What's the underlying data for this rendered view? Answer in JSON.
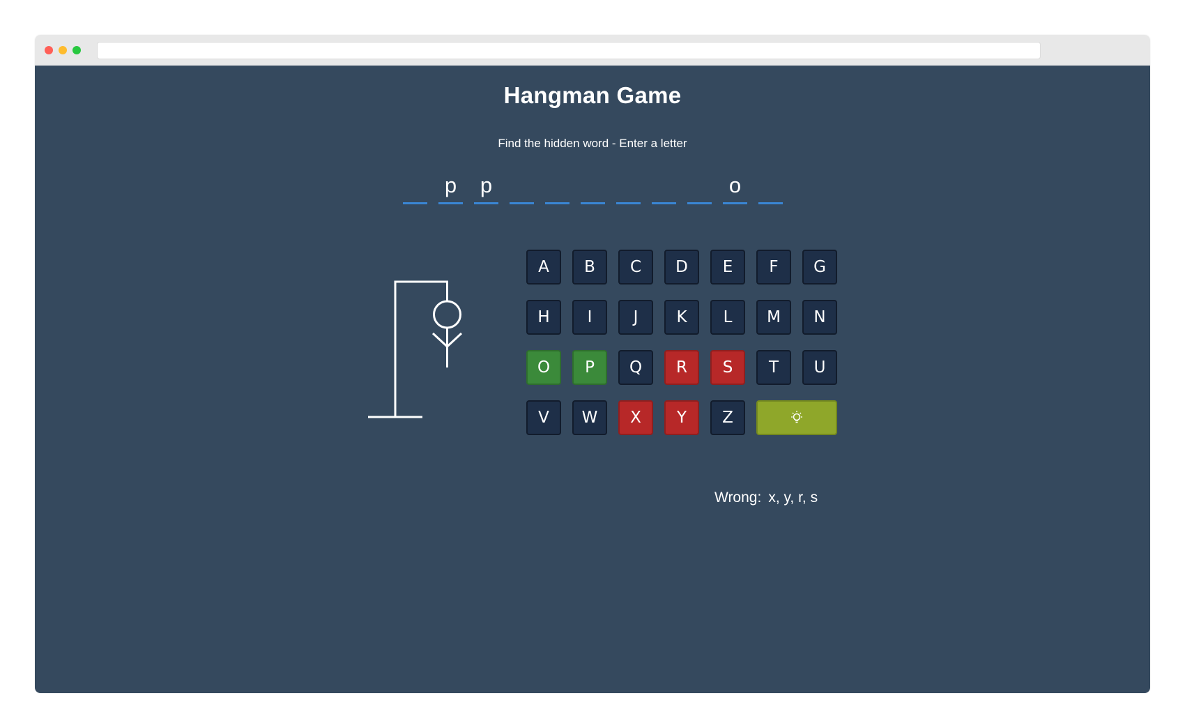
{
  "browser": {
    "url": ""
  },
  "game": {
    "title": "Hangman Game",
    "subtitle": "Find the hidden word - Enter a letter",
    "word_slots": [
      "",
      "p",
      "p",
      "",
      "",
      "",
      "",
      "",
      "",
      "o",
      ""
    ],
    "keyboard": {
      "rows": [
        [
          {
            "letter": "A",
            "state": "unused"
          },
          {
            "letter": "B",
            "state": "unused"
          },
          {
            "letter": "C",
            "state": "unused"
          },
          {
            "letter": "D",
            "state": "unused"
          },
          {
            "letter": "E",
            "state": "unused"
          },
          {
            "letter": "F",
            "state": "unused"
          },
          {
            "letter": "G",
            "state": "unused"
          }
        ],
        [
          {
            "letter": "H",
            "state": "unused"
          },
          {
            "letter": "I",
            "state": "unused"
          },
          {
            "letter": "J",
            "state": "unused"
          },
          {
            "letter": "K",
            "state": "unused"
          },
          {
            "letter": "L",
            "state": "unused"
          },
          {
            "letter": "M",
            "state": "unused"
          },
          {
            "letter": "N",
            "state": "unused"
          }
        ],
        [
          {
            "letter": "O",
            "state": "correct"
          },
          {
            "letter": "P",
            "state": "correct"
          },
          {
            "letter": "Q",
            "state": "unused"
          },
          {
            "letter": "R",
            "state": "wrong"
          },
          {
            "letter": "S",
            "state": "wrong"
          },
          {
            "letter": "T",
            "state": "unused"
          },
          {
            "letter": "U",
            "state": "unused"
          }
        ],
        [
          {
            "letter": "V",
            "state": "unused"
          },
          {
            "letter": "W",
            "state": "unused"
          },
          {
            "letter": "X",
            "state": "wrong"
          },
          {
            "letter": "Y",
            "state": "wrong"
          },
          {
            "letter": "Z",
            "state": "unused"
          }
        ]
      ],
      "hint_icon": "lightbulb-icon"
    },
    "wrong_label": "Wrong:",
    "wrong_letters": "x, y, r, s",
    "colors": {
      "background": "#35495e",
      "key": "#1e2f48",
      "correct": "#3b8a3a",
      "wrong": "#b72828",
      "hint": "#8fa72a",
      "slot_underline": "#3a86d4"
    }
  }
}
